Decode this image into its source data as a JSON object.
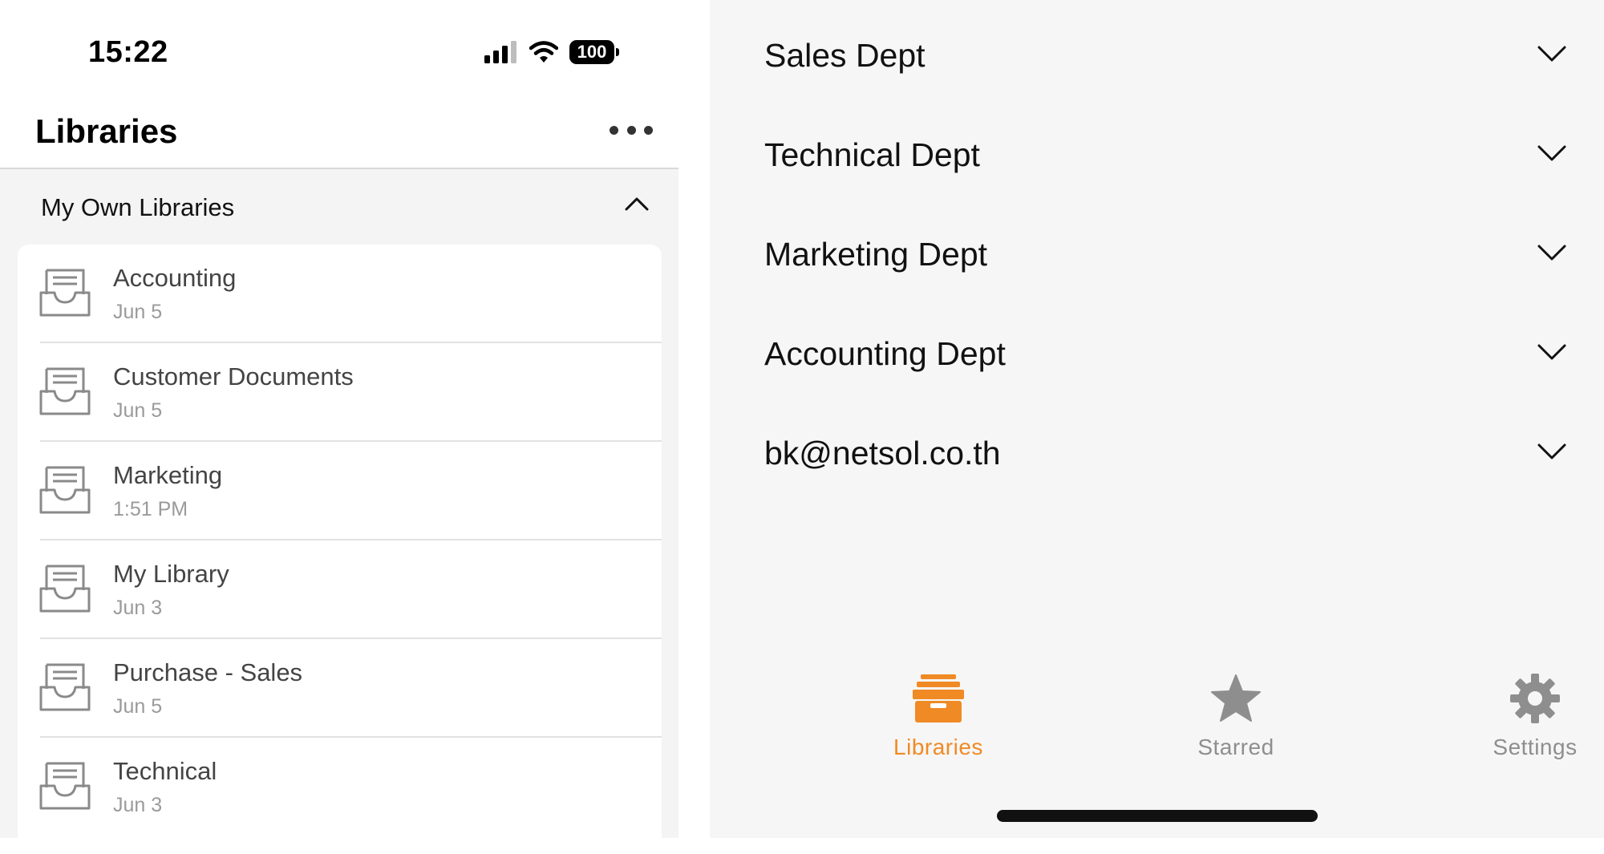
{
  "status_bar": {
    "time": "15:22",
    "battery": "100"
  },
  "header": {
    "title": "Libraries"
  },
  "section": {
    "title": "My Own Libraries"
  },
  "libraries": [
    {
      "name": "Accounting",
      "date": "Jun 5"
    },
    {
      "name": "Customer Documents",
      "date": "Jun 5"
    },
    {
      "name": "Marketing",
      "date": "1:51 PM"
    },
    {
      "name": "My Library",
      "date": "Jun 3"
    },
    {
      "name": "Purchase - Sales",
      "date": "Jun 5"
    },
    {
      "name": "Technical",
      "date": "Jun 3"
    }
  ],
  "departments": [
    {
      "name": "Sales Dept"
    },
    {
      "name": "Technical Dept"
    },
    {
      "name": "Marketing Dept"
    },
    {
      "name": "Accounting Dept"
    },
    {
      "name": "bk@netsol.co.th"
    }
  ],
  "tabs": [
    {
      "label": "Libraries",
      "icon": "library-box-icon",
      "active": true
    },
    {
      "label": "Starred",
      "icon": "star-icon",
      "active": false
    },
    {
      "label": "Settings",
      "icon": "gear-icon",
      "active": false
    }
  ],
  "colors": {
    "accent": "#f08a24",
    "inactive": "#8e8e8e"
  }
}
